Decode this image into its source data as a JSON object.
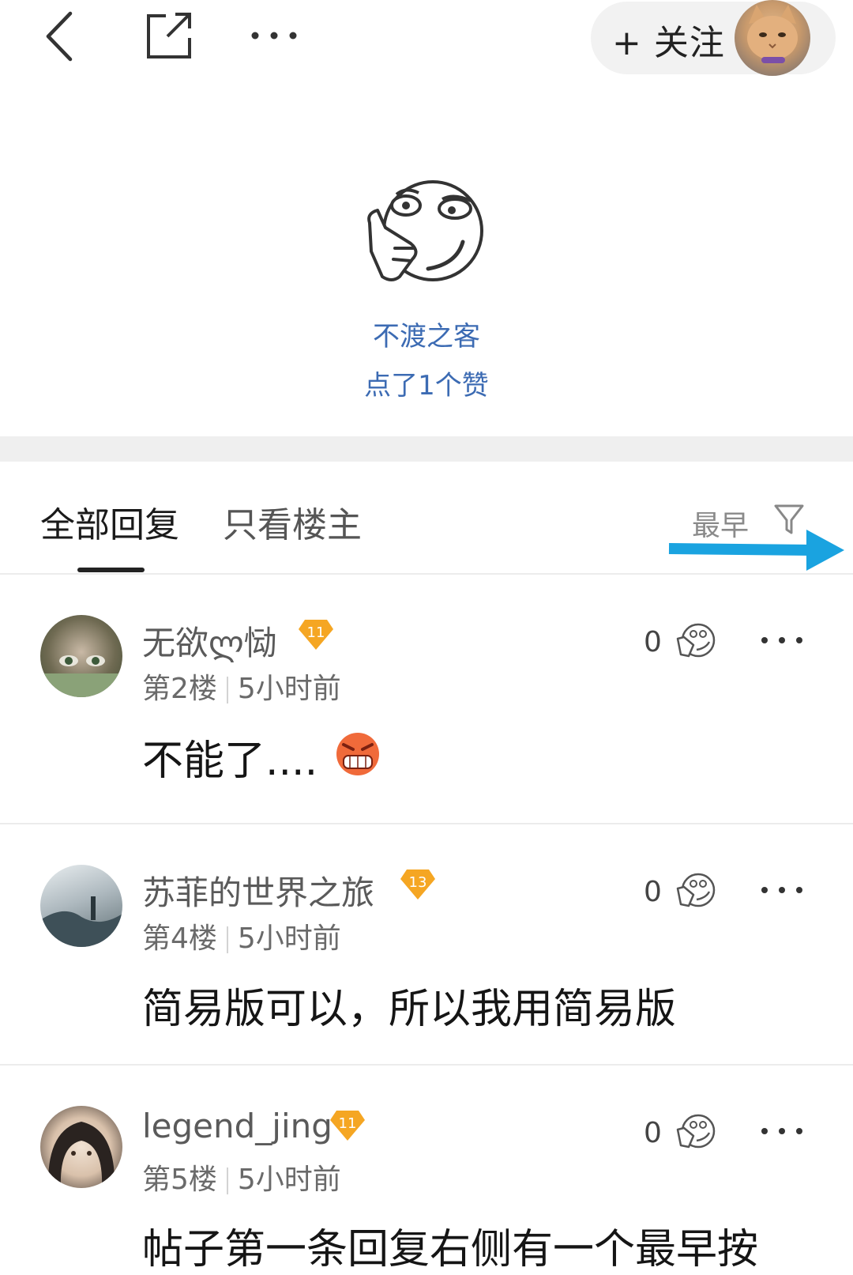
{
  "header": {
    "back_icon": "back-arrow-icon",
    "share_icon": "share-external-icon",
    "more_icon": "more-dots-icon",
    "follow_label": "+ 关注"
  },
  "like_section": {
    "emoji_icon": "thinking-thumb-emoji",
    "liker_name": "不渡之客",
    "liker_text": "点了1个赞"
  },
  "tabs": {
    "all_replies": "全部回复",
    "owner_only": "只看楼主",
    "sort_label": "最早",
    "filter_icon": "filter-funnel-icon"
  },
  "annotation": {
    "color": "#1aa3e0"
  },
  "comments": [
    {
      "name": "无欲ლ恸",
      "badge": "11",
      "floor": "第2楼",
      "time": "5小时前",
      "like_count": "0",
      "body": "不能了....",
      "body_emoji": "angry-face-emoji"
    },
    {
      "name": "苏菲的世界之旅",
      "badge": "13",
      "floor": "第4楼",
      "time": "5小时前",
      "like_count": "0",
      "body": "简易版可以，所以我用简易版"
    },
    {
      "name": "legend_jing",
      "badge": "11",
      "floor": "第5楼",
      "time": "5小时前",
      "like_count": "0",
      "body": "帖子第一条回复右侧有一个最早按"
    }
  ],
  "colors": {
    "link_blue": "#3c6bb3",
    "badge_orange": "#f5a623",
    "divider_gray": "#efefef"
  }
}
